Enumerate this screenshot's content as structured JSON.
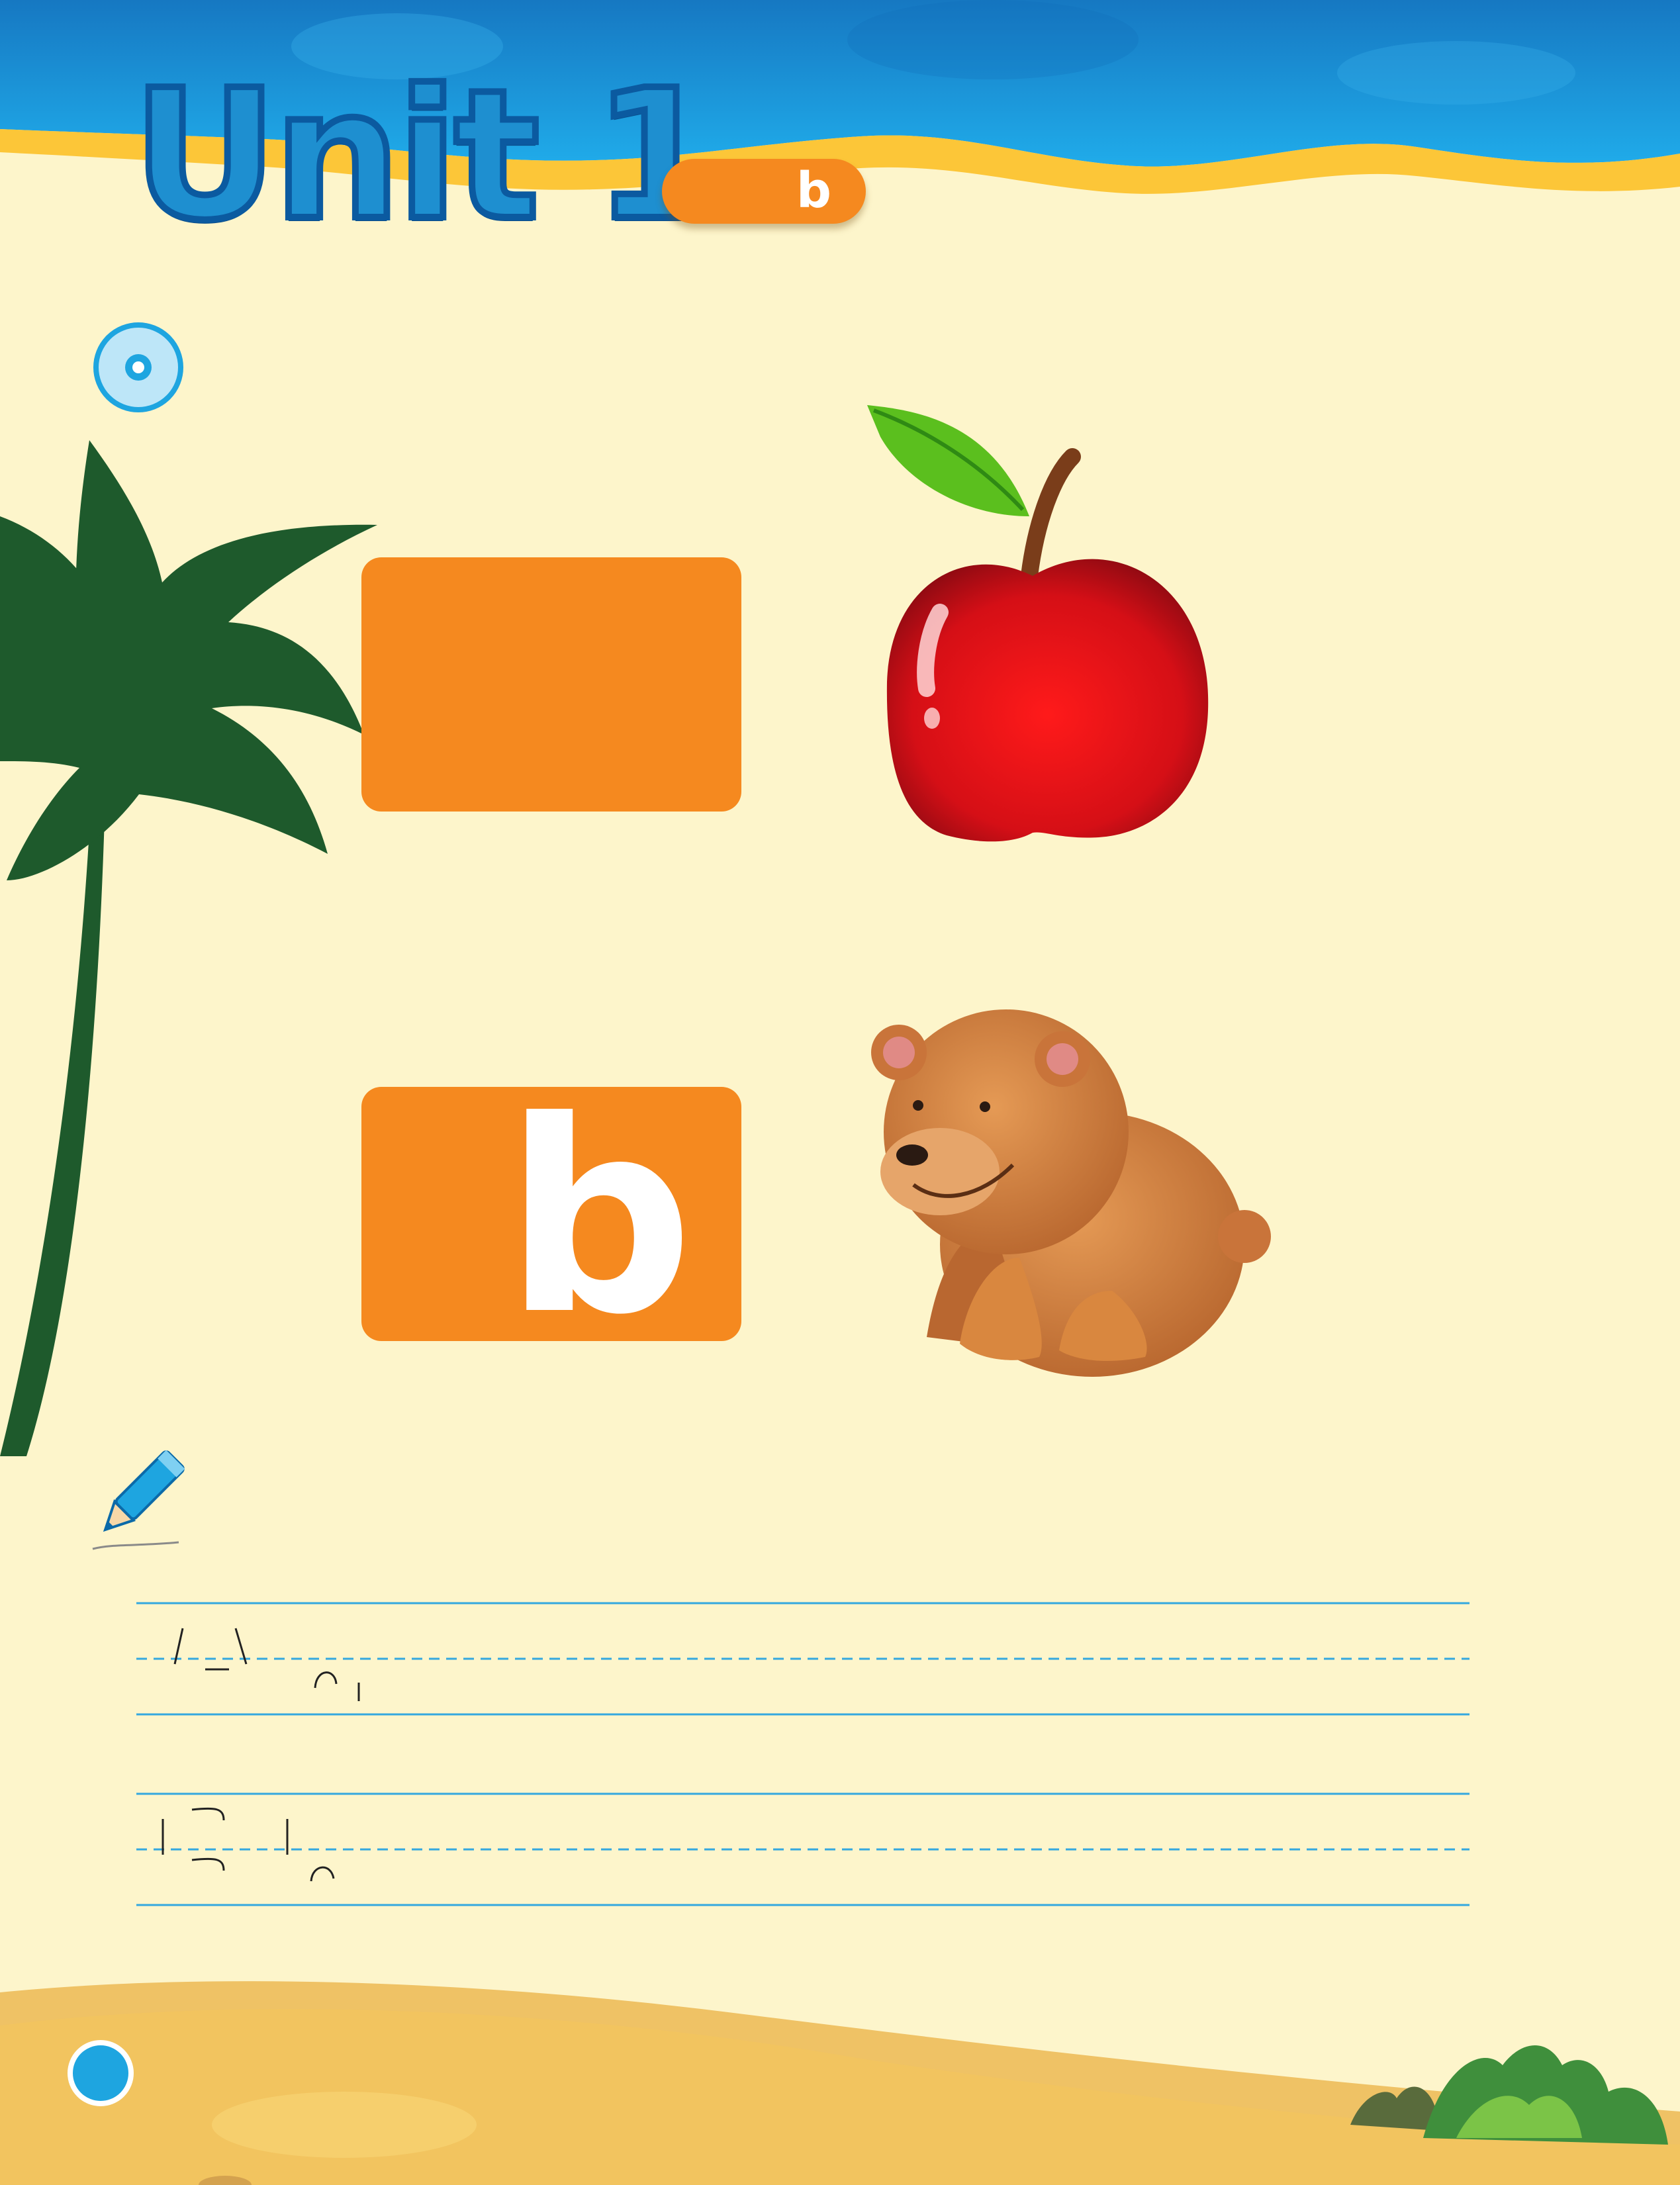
{
  "header": {
    "unit_title": "Unit 1",
    "letter_pill": "b"
  },
  "cards": [
    {
      "letter": "",
      "picture": "apple"
    },
    {
      "letter": "b",
      "picture": "bear"
    }
  ],
  "icons": {
    "audio": "audio-cd-icon",
    "write": "pencil-icon",
    "page": "page-number-dot"
  },
  "colors": {
    "background": "#fdf5cb",
    "sea": "#1ea5e0",
    "shore": "#fcc638",
    "accent_orange": "#f5891f",
    "palm": "#1e5a2c",
    "sand": "#efc265",
    "guide_line": "#34a8df"
  }
}
